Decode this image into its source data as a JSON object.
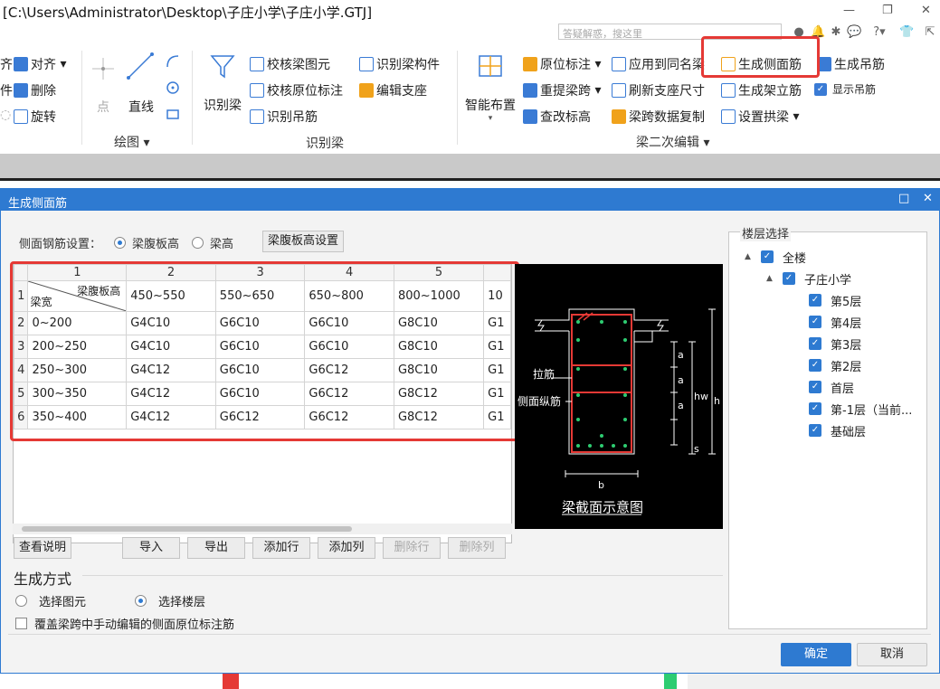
{
  "window": {
    "title": "[C:\\Users\\Administrator\\Desktop\\子庄小学\\子庄小学.GTJ]",
    "search_placeholder": "答疑解惑，搜这里",
    "minimize": "—",
    "restore": "❐",
    "close": "✕"
  },
  "ribbon": {
    "partial_left": [
      {
        "label": "齐"
      },
      {
        "label": "件"
      }
    ],
    "edit_items": [
      {
        "label": "对齐",
        "icon": "align-icon"
      },
      {
        "label": "删除",
        "icon": "delete-icon"
      },
      {
        "label": "旋转",
        "icon": "rotate-icon"
      }
    ],
    "draw": {
      "point_label": "点",
      "line_label": "直线",
      "group_label": "绘图"
    },
    "identify": {
      "big_label": "识别梁",
      "items": [
        {
          "label": "校核梁图元",
          "icon": "check-beam-icon"
        },
        {
          "label": "识别梁构件",
          "icon": "identify-beam-component-icon"
        },
        {
          "label": "校核原位标注",
          "icon": "check-annotation-icon"
        },
        {
          "label": "编辑支座",
          "icon": "edit-support-icon"
        },
        {
          "label": "识别吊筋",
          "icon": "identify-hanger-icon"
        }
      ],
      "group_label": "识别梁"
    },
    "secondary": {
      "big_label": "智能布置",
      "items": [
        {
          "label": "原位标注",
          "icon": "annotation-icon"
        },
        {
          "label": "应用到同名梁",
          "icon": "apply-same-beam-icon"
        },
        {
          "label": "生成侧面筋",
          "icon": "side-rebar-icon"
        },
        {
          "label": "生成吊筋",
          "icon": "hanger-rebar-icon"
        },
        {
          "label": "重提梁跨",
          "icon": "re-span-icon"
        },
        {
          "label": "刷新支座尺寸",
          "icon": "refresh-support-icon"
        },
        {
          "label": "生成架立筋",
          "icon": "erection-rebar-icon"
        },
        {
          "label": "显示吊筋",
          "icon": "show-hanger-checkbox"
        },
        {
          "label": "查改标高",
          "icon": "elevation-icon"
        },
        {
          "label": "梁跨数据复制",
          "icon": "copy-span-icon"
        },
        {
          "label": "设置拱梁",
          "icon": "arch-beam-icon"
        }
      ],
      "group_label": "梁二次编辑"
    }
  },
  "dialog": {
    "title": "生成侧面筋",
    "setting_label": "侧面钢筋设置：",
    "radio_web_height": "梁腹板高",
    "radio_beam_height": "梁高",
    "web_height_btn": "梁腹板高设置",
    "table": {
      "col_headers": [
        "1",
        "2",
        "3",
        "4",
        "5",
        ""
      ],
      "diag_top": "梁腹板高",
      "diag_bottom": "梁宽",
      "header_values": [
        "450~550",
        "550~650",
        "650~800",
        "800~1000",
        "10"
      ],
      "rows": [
        {
          "num": "2",
          "width": "0~200",
          "cells": [
            "G4C10",
            "G6C10",
            "G6C10",
            "G8C10",
            "G1"
          ]
        },
        {
          "num": "3",
          "width": "200~250",
          "cells": [
            "G4C10",
            "G6C10",
            "G6C10",
            "G8C10",
            "G1"
          ]
        },
        {
          "num": "4",
          "width": "250~300",
          "cells": [
            "G4C12",
            "G6C10",
            "G6C12",
            "G8C10",
            "G1"
          ]
        },
        {
          "num": "5",
          "width": "300~350",
          "cells": [
            "G4C12",
            "G6C10",
            "G6C12",
            "G8C12",
            "G1"
          ]
        },
        {
          "num": "6",
          "width": "350~400",
          "cells": [
            "G4C12",
            "G6C12",
            "G6C12",
            "G8C12",
            "G1"
          ]
        }
      ],
      "header_row_num": "1"
    },
    "buttons": {
      "view_desc": "查看说明",
      "import": "导入",
      "export": "导出",
      "add_row": "添加行",
      "add_col": "添加列",
      "delete_row": "删除行",
      "delete_col": "删除列"
    },
    "diagram": {
      "caption": "梁截面示意图",
      "tie_label": "拉筋",
      "side_label": "侧面纵筋",
      "a": "a",
      "s": "s",
      "hw": "hw",
      "h": "h",
      "b": "b"
    },
    "mode": {
      "title": "生成方式",
      "opt_element": "选择图元",
      "opt_floor": "选择楼层",
      "override": "覆盖梁跨中手动编辑的侧面原位标注筋"
    },
    "floor": {
      "title": "楼层选择",
      "all": "全楼",
      "project": "子庄小学",
      "floors": [
        "第5层",
        "第4层",
        "第3层",
        "第2层",
        "首层",
        "第-1层（当前...",
        "基础层"
      ]
    },
    "ok": "确定",
    "cancel": "取消"
  }
}
